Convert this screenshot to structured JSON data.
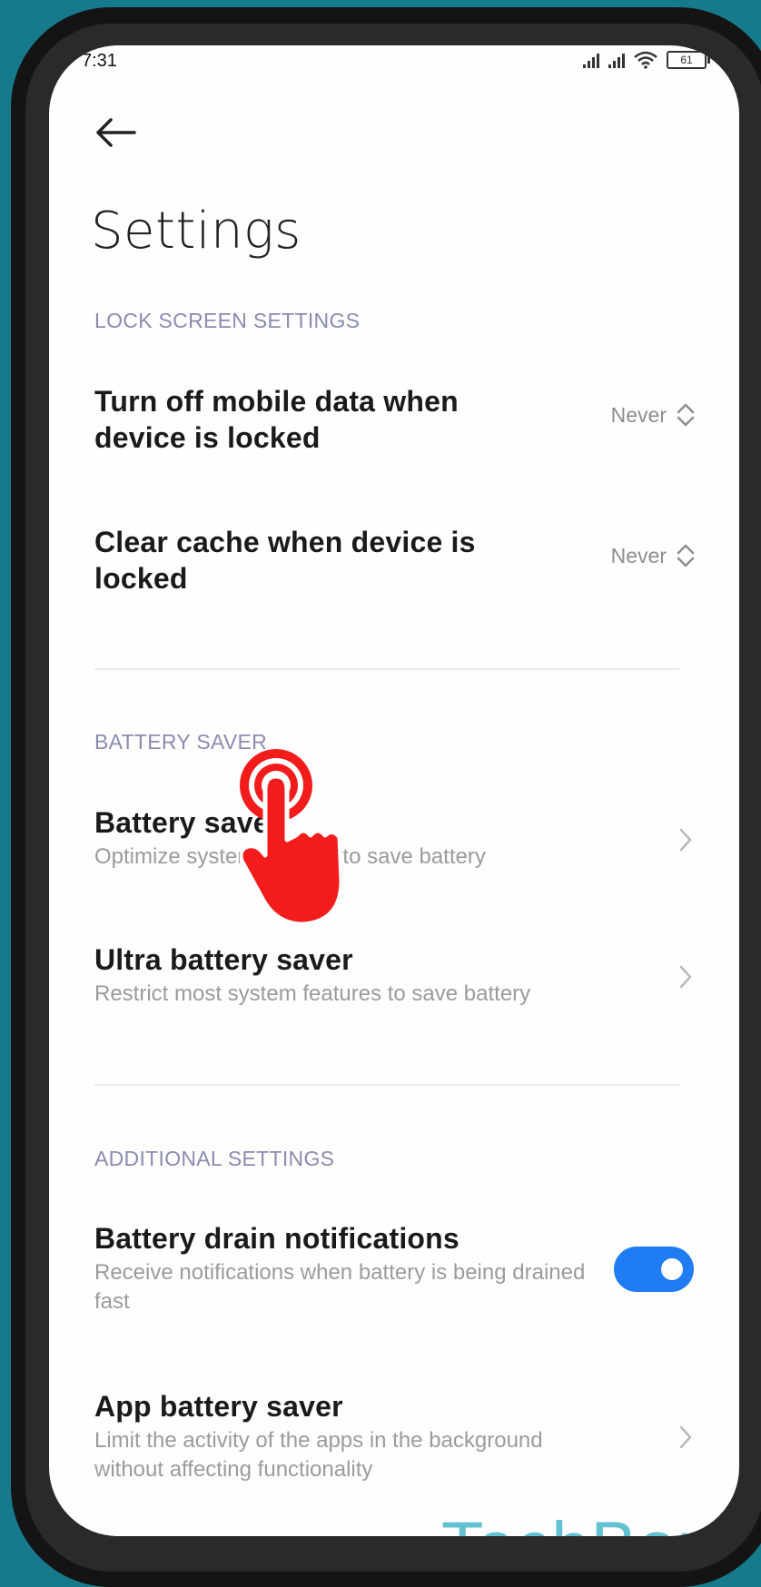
{
  "status_bar": {
    "time": "7:31",
    "battery": "61"
  },
  "header": {
    "title": "Settings"
  },
  "sections": {
    "lock_screen": {
      "header": "LOCK SCREEN SETTINGS",
      "items": [
        {
          "title": "Turn off mobile data when device is locked",
          "value": "Never"
        },
        {
          "title": "Clear cache when device is locked",
          "value": "Never"
        }
      ]
    },
    "battery_saver": {
      "header": "BATTERY SAVER",
      "items": [
        {
          "title": "Battery saver",
          "subtitle": "Optimize system settings to save battery"
        },
        {
          "title": "Ultra battery saver",
          "subtitle": "Restrict most system features to save battery"
        }
      ]
    },
    "additional": {
      "header": "ADDITIONAL SETTINGS",
      "items": [
        {
          "title": "Battery drain notifications",
          "subtitle": "Receive notifications when battery is being drained fast",
          "toggle_on": true
        },
        {
          "title": "App battery saver",
          "subtitle": "Limit the activity of the apps in the background without affecting functionality"
        }
      ]
    }
  },
  "watermark": "TechBone",
  "colors": {
    "background": "#177a8c",
    "toggle_on": "#1f7cf2",
    "tap_hand": "#f21c1c",
    "section_header": "#8b8bb0"
  },
  "icons": [
    "back-arrow-icon",
    "signal-icon",
    "wifi-icon",
    "battery-icon",
    "up-down-chevron-icon",
    "chevron-right-icon",
    "tap-hand-icon"
  ]
}
